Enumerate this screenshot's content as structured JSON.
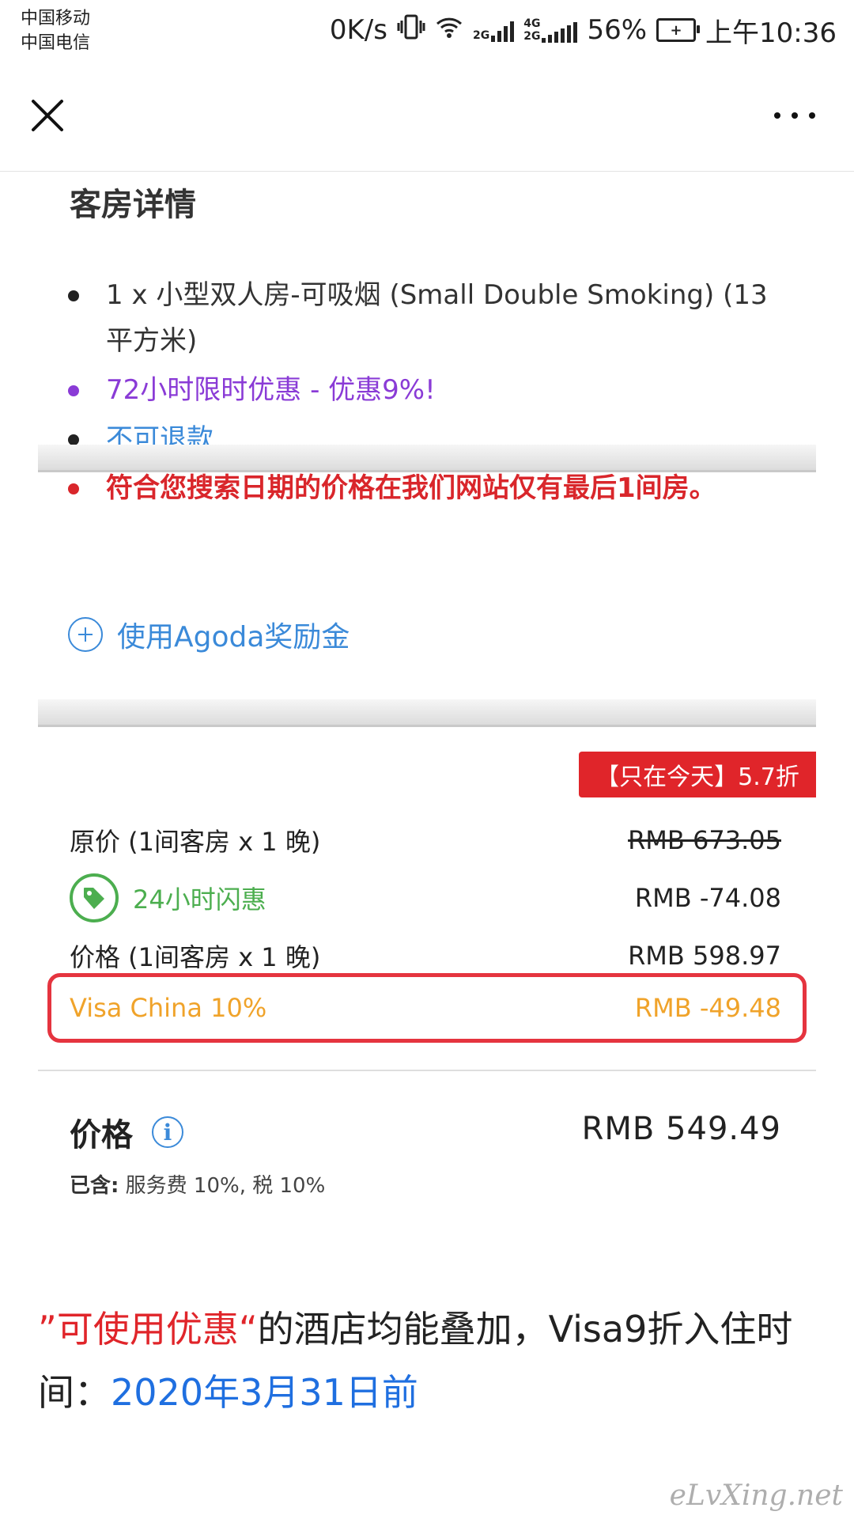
{
  "status_bar": {
    "carrier1": "中国移动",
    "carrier2": "中国电信",
    "speed": "0K/s",
    "net1": "2G",
    "net2": "4G",
    "net2b": "2G",
    "battery": "56%",
    "time": "上午10:36"
  },
  "nav": {
    "close_icon": "close-icon",
    "more_icon": "more-icon"
  },
  "room": {
    "title": "客房详情",
    "bullets": [
      {
        "text": "1 x 小型双人房-可吸烟 (Small Double Smoking) (13 平方米)",
        "color": "#333333"
      },
      {
        "text": "72小时限时优惠 - 优惠9%!",
        "color": "#8a3bd6"
      },
      {
        "text": "不可退款",
        "color": "#3b8ad9"
      },
      {
        "text": "符合您搜索日期的价格在我们网站仅有最后1间房。",
        "color": "#d9262b"
      }
    ]
  },
  "reward": {
    "label": "使用Agoda奖励金"
  },
  "pricing": {
    "badge": "【只在今天】5.7折",
    "original_label": "原价 (1间客房 x 1 晚)",
    "original_value": "RMB 673.05",
    "flash_label": "24小时闪惠",
    "flash_value": "RMB -74.08",
    "price_label": "价格 (1间客房 x 1 晚)",
    "price_value": "RMB 598.97",
    "visa_label": "Visa China 10%",
    "visa_value": "RMB -49.48",
    "total_label": "价格",
    "total_value": "RMB 549.49",
    "included_prefix": "已含:",
    "included_text": "服务费 10%, 税 10%"
  },
  "caption": {
    "quote": "”可使用优惠“",
    "text1": "的酒店均能叠加，Visa9折入住时间：",
    "date": "2020年3月31日前"
  },
  "watermark": "eLvXing.net",
  "colors": {
    "red": "#e0252a",
    "blue": "#3b8ad9",
    "green": "#4cae4f",
    "orange": "#f0a32a"
  }
}
